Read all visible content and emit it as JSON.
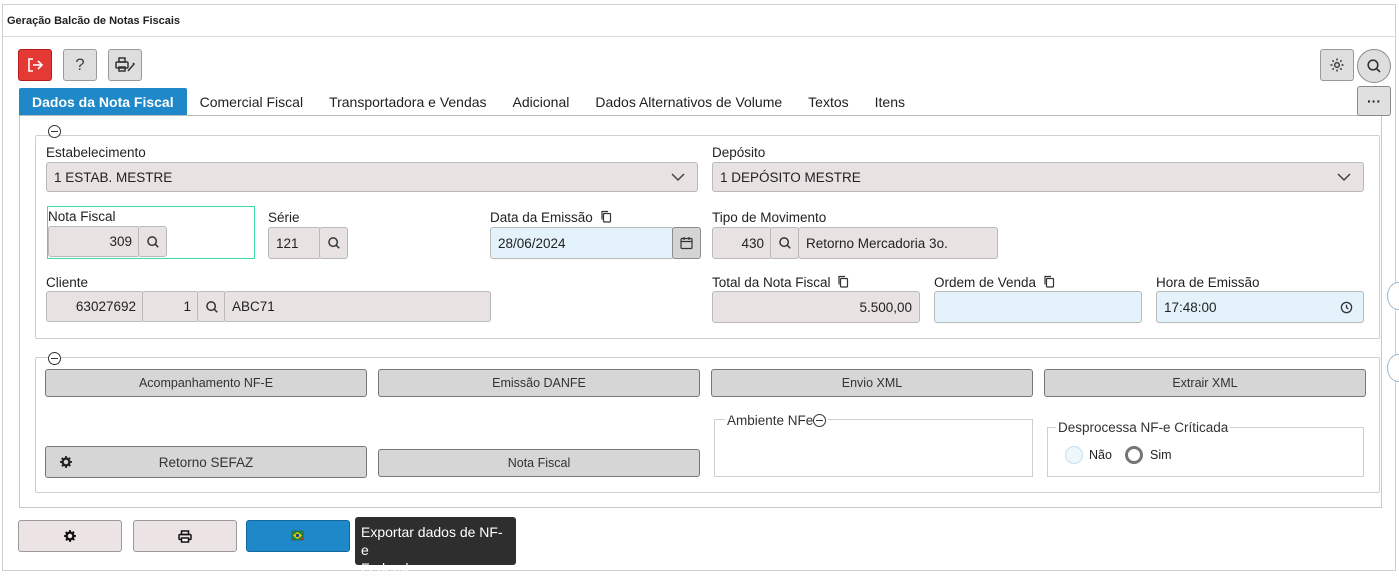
{
  "window": {
    "title": "Geração Balcão de Notas Fiscais"
  },
  "tabs": [
    {
      "label": "Dados da Nota Fiscal",
      "active": true
    },
    {
      "label": "Comercial Fiscal"
    },
    {
      "label": "Transportadora e Vendas"
    },
    {
      "label": "Adicional"
    },
    {
      "label": "Dados Alternativos de Volume"
    },
    {
      "label": "Textos"
    },
    {
      "label": "Itens"
    }
  ],
  "toolbar": {
    "help_label": "?",
    "more_label": "···"
  },
  "form": {
    "estabelecimento": {
      "label": "Estabelecimento",
      "value": "1 ESTAB. MESTRE"
    },
    "deposito": {
      "label": "Depósito",
      "value": "1 DEPÓSITO MESTRE"
    },
    "nota_fiscal": {
      "label": "Nota Fiscal",
      "value": "309"
    },
    "serie": {
      "label": "Série",
      "value": "121"
    },
    "data_emissao": {
      "label": "Data da Emissão",
      "value": "28/06/2024"
    },
    "tipo_movimento": {
      "label": "Tipo de Movimento",
      "code": "430",
      "description": "Retorno Mercadoria 3o."
    },
    "cliente": {
      "label": "Cliente",
      "code": "63027692",
      "seq": "1",
      "name": "ABC71"
    },
    "total_nf": {
      "label": "Total da Nota Fiscal",
      "value": "5.500,00"
    },
    "ordem_venda": {
      "label": "Ordem de Venda",
      "value": ""
    },
    "hora_emissao": {
      "label": "Hora de Emissão",
      "value": "17:48:00"
    }
  },
  "actions": {
    "acompanhamento": "Acompanhamento NF-E",
    "emissao_danfe": "Emissão DANFE",
    "envio_xml": "Envio XML",
    "extrair_xml": "Extrair XML",
    "retorno_sefaz": "Retorno SEFAZ",
    "nota_fiscal": "Nota Fiscal"
  },
  "ambiente": {
    "label": "Ambiente NFe"
  },
  "desprocessa": {
    "label": "Desprocessa NF-e Críticada",
    "options": [
      {
        "label": "Não",
        "selected": false
      },
      {
        "label": "Sim",
        "selected": true
      }
    ]
  },
  "tooltip": {
    "text_line1": "Exportar dados de NF-e",
    "text_line2": "Federal"
  },
  "colors": {
    "accent": "#1e88c8",
    "exit_red": "#e53935",
    "focus_border": "#3ddba7",
    "field_bg": "#e9e2e2",
    "field_blue": "#e3f2fb"
  }
}
